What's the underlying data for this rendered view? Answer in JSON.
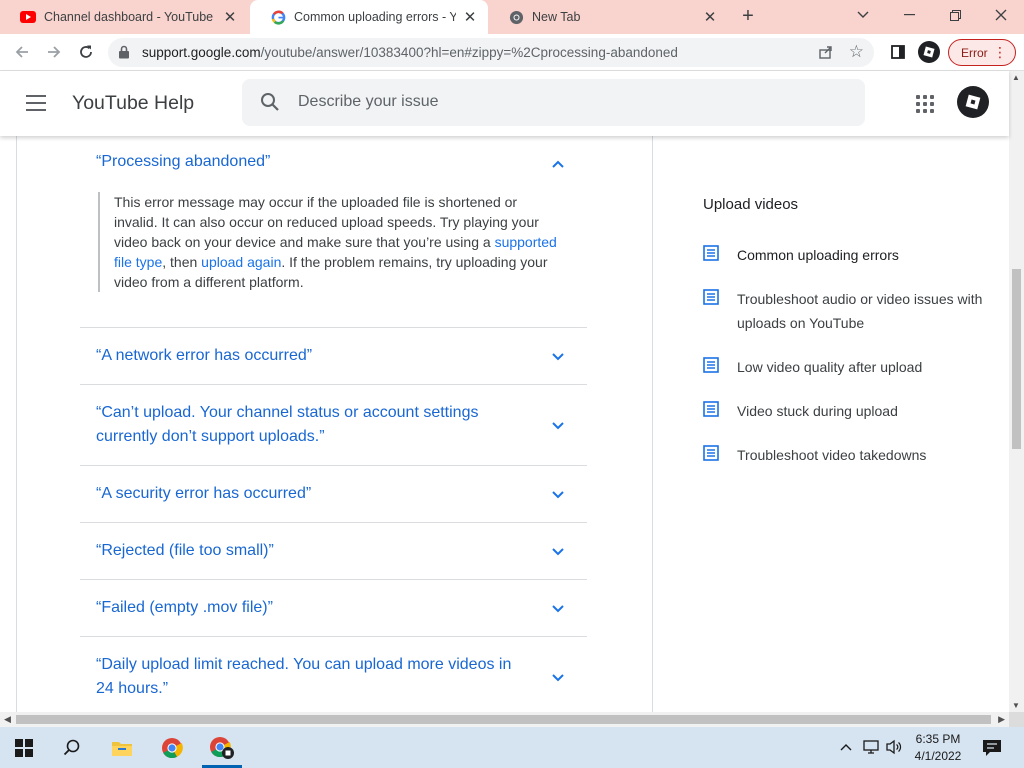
{
  "browser": {
    "tabs": [
      {
        "title": "Channel dashboard - YouTube St",
        "icon": "youtube-icon"
      },
      {
        "title": "Common uploading errors - You",
        "icon": "google-g-icon",
        "active": true
      },
      {
        "title": "New Tab",
        "icon": "chrome-icon"
      }
    ],
    "url_host": "support.google.com",
    "url_path": "/youtube/answer/10383400?hl=en#zippy=%2Cprocessing-abandoned",
    "profile_status": "Error"
  },
  "help": {
    "title": "YouTube Help",
    "search_placeholder": "Describe your issue"
  },
  "article": {
    "open_item": {
      "title": "“Processing abandoned”",
      "body_1": "This error message may occur if the uploaded file is shortened or invalid. It can also occur on reduced upload speeds. Try playing your video back on your device and make sure that you’re using a ",
      "link_1": "supported file type",
      "body_2": ", then ",
      "link_2": "upload again",
      "body_3": ". If the problem remains, try uploading your video from a different platform."
    },
    "items": [
      "“A network error has occurred”",
      "“Can’t upload. Your channel status or account settings currently don’t support uploads.”",
      "“A security error has occurred”",
      "“Rejected (file too small)”",
      "“Failed (empty .mov file)”",
      "“Daily upload limit reached. You can upload more videos in 24 hours.”"
    ]
  },
  "sidebar": {
    "title": "Upload videos",
    "items": [
      "Common uploading errors",
      "Troubleshoot audio or video issues with uploads on YouTube",
      "Low video quality after upload",
      "Video stuck during upload",
      "Troubleshoot video takedowns"
    ]
  },
  "taskbar": {
    "time": "6:35 PM",
    "date": "4/1/2022"
  },
  "colors": {
    "link": "#1967d2",
    "tabstrip": "#f9d3cd",
    "taskbar": "#d6e3f0"
  }
}
